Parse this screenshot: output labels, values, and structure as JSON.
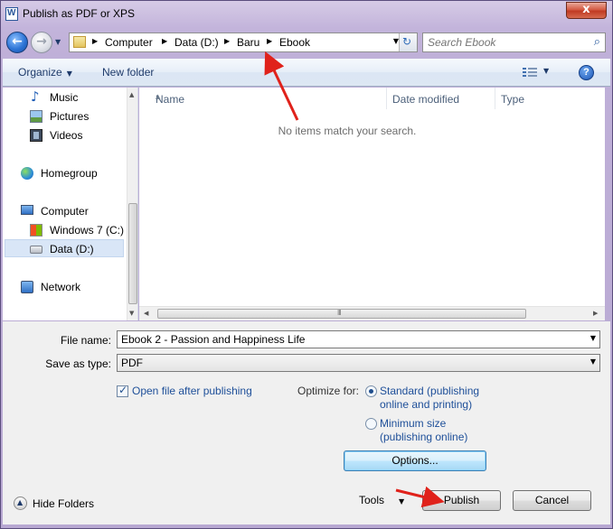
{
  "window": {
    "title": "Publish as PDF or XPS",
    "close_glyph": "x"
  },
  "nav": {
    "back_glyph": "←",
    "forward_glyph": "→",
    "history_glyph": "▼",
    "breadcrumbs": [
      "Computer",
      "Data (D:)",
      "Baru",
      "Ebook"
    ],
    "crumb_sep": "▶",
    "address_drop": "▼",
    "refresh_glyph": "↻",
    "search_placeholder": "Search Ebook",
    "search_glyph": "⌕"
  },
  "toolbar": {
    "organize_label": "Organize",
    "caret": "▼",
    "new_folder_label": "New folder",
    "view_drop": "▼",
    "help_glyph": "?"
  },
  "sidebar": {
    "items": [
      {
        "label": "Music",
        "icon": "music-icon"
      },
      {
        "label": "Pictures",
        "icon": "pictures-icon"
      },
      {
        "label": "Videos",
        "icon": "videos-icon"
      },
      {
        "label": "Homegroup",
        "icon": "homegroup-icon"
      },
      {
        "label": "Computer",
        "icon": "computer-icon"
      },
      {
        "label": "Windows 7 (C:)",
        "icon": "windows-drive-icon"
      },
      {
        "label": "Data (D:)",
        "icon": "drive-icon",
        "selected": true
      },
      {
        "label": "Network",
        "icon": "network-icon"
      }
    ],
    "scroll_up": "▲",
    "scroll_down": "▼"
  },
  "file_list": {
    "columns": [
      "Name",
      "Date modified",
      "Type"
    ],
    "sort_glyph": "▲",
    "empty_message": "No items match your search.",
    "scroll_left": "◀",
    "scroll_right": "▶",
    "grip": "III"
  },
  "form": {
    "file_name_label": "File name:",
    "file_name_value": "Ebook 2 - Passion and Happiness Life",
    "save_type_label": "Save as type:",
    "save_type_value": "PDF",
    "drop_glyph": "▼",
    "open_after_label": "Open file after publishing",
    "open_after_checked": true,
    "optimize_label": "Optimize for:",
    "standard_line1": "Standard (publishing",
    "standard_line2": "online and printing)",
    "minimum_line1": "Minimum size",
    "minimum_line2": "(publishing online)",
    "options_button": "Options...",
    "hide_folders_label": "Hide Folders",
    "hide_folders_glyph": "▲",
    "tools_label": "Tools",
    "tools_drop": "▼",
    "publish_button": "Publish",
    "cancel_button": "Cancel"
  },
  "colors": {
    "annotation_arrow": "#e0221b",
    "link_blue": "#1e4f99",
    "frame": "#bfb0d8"
  }
}
